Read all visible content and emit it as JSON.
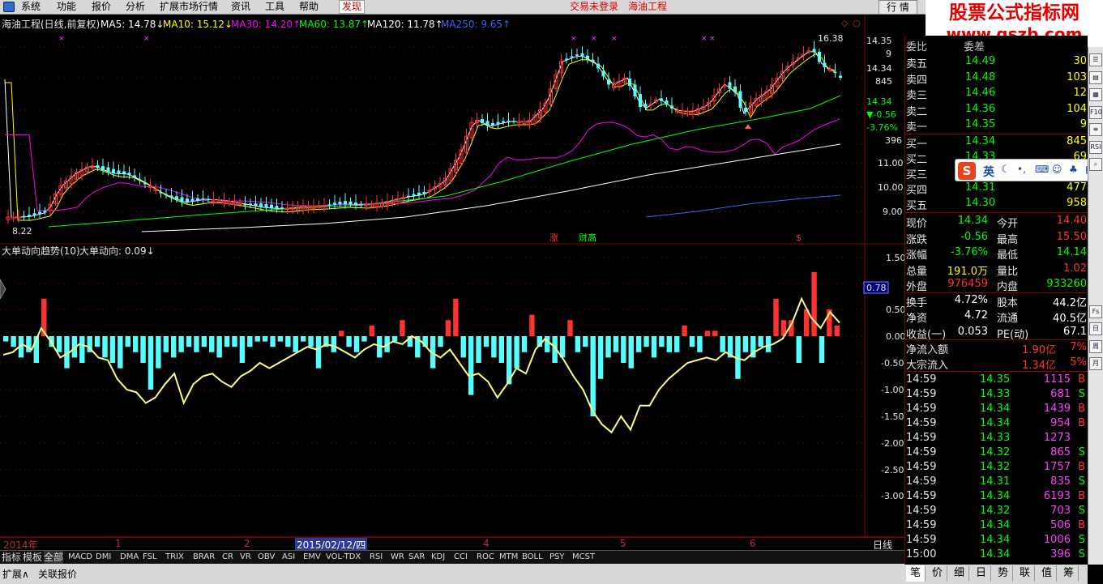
{
  "menu": {
    "items": [
      "系统",
      "功能",
      "报价",
      "分析",
      "扩展市场行情",
      "资讯",
      "工具",
      "帮助"
    ],
    "active": "发现",
    "login": "交易未登录",
    "stock_name": "海油工程",
    "trade_tab": "行 情"
  },
  "banner": {
    "line1": "股票公式指标网",
    "line2": "www.gszb.com"
  },
  "ma_legend": {
    "title": "海油工程(日线,前复权)",
    "ma5": "MA5: 14.78↓",
    "ma10": "MA10: 15.12↓",
    "ma30": "MA30: 14.20↑",
    "ma60": "MA60: 13.87↑",
    "ma120": "MA120: 11.78↑",
    "ma250": "MA250: 9.65↑"
  },
  "colors": {
    "ma5": "#ffffff",
    "ma10": "#ffff00",
    "ma30": "#ff00ff",
    "ma60": "#00ff00",
    "ma120": "#ffffff",
    "ma250": "#4060ff",
    "up": "#ff3232",
    "down": "#54ffff",
    "panel_border": "#8b0000",
    "price_red": "#ff3232",
    "price_green": "#00ff00",
    "label_grey": "#e6e6e6"
  },
  "price_axis": {
    "labels": [
      "14.35",
      "9",
      "14.34",
      "845",
      "14.34",
      "▼-0.56",
      "-3.76%",
      "396",
      "11.00",
      "10.00",
      "9.00"
    ],
    "high_label": "16.38",
    "low_label": "8.22"
  },
  "indicator": {
    "title": "大单动向趋势(10)",
    "sub": "大单动向: 0.09↓",
    "value_box": "0.78",
    "axis": [
      "1.50",
      "0.50",
      "0.00",
      "-0.50",
      "-1.00",
      "-1.50",
      "-2.00",
      "-2.50",
      "-3.00"
    ]
  },
  "date_axis": {
    "labels": [
      "2014年",
      "1",
      "2",
      "2015/02/12/四",
      "4",
      "5",
      "6"
    ],
    "period": "日线",
    "zoom": [
      "+",
      "-",
      "0"
    ]
  },
  "signal_labels": {
    "s1": "涨",
    "s2": "财高",
    "s3": "$"
  },
  "bottom_tabs": [
    "指标",
    "模板",
    "全部",
    "MACD",
    "DMI",
    "DMA",
    "FSL",
    "TRIX",
    "BRAR",
    "CR",
    "VR",
    "OBV",
    "ASI",
    "EMV",
    "VOL-TDX",
    "RSI",
    "WR",
    "SAR",
    "KDJ",
    "CCI",
    "ROC",
    "MTM",
    "BOLL",
    "PSY",
    "MCST"
  ],
  "status": {
    "expand": "扩展∧",
    "linked": "关联报价"
  },
  "order_book": {
    "top_partial": {
      "label": "委比",
      "value": "委差"
    },
    "asks": [
      {
        "label": "卖五",
        "price": "14.49",
        "vol": "30"
      },
      {
        "label": "卖四",
        "price": "14.48",
        "vol": "103"
      },
      {
        "label": "卖三",
        "price": "14.46",
        "vol": "12"
      },
      {
        "label": "卖二",
        "price": "14.36",
        "vol": "104"
      },
      {
        "label": "卖一",
        "price": "14.35",
        "vol": "9"
      }
    ],
    "bids": [
      {
        "label": "买一",
        "price": "14.34",
        "vol": "845"
      },
      {
        "label": "买二",
        "price": "14.33",
        "vol": "69"
      },
      {
        "label": "买三",
        "price": "",
        "vol": ""
      },
      {
        "label": "买四",
        "price": "14.31",
        "vol": "477"
      },
      {
        "label": "买五",
        "price": "14.30",
        "vol": "958"
      }
    ]
  },
  "quote": [
    {
      "l1": "现价",
      "v1": "14.34",
      "c1": "green",
      "l2": "今开",
      "v2": "14.40",
      "c2": "red"
    },
    {
      "l1": "涨跌",
      "v1": "-0.56",
      "c1": "green",
      "l2": "最高",
      "v2": "15.50",
      "c2": "red"
    },
    {
      "l1": "涨幅",
      "v1": "-3.76%",
      "c1": "green",
      "l2": "最低",
      "v2": "14.14",
      "c2": "green"
    },
    {
      "l1": "总量",
      "v1": "191.0万",
      "c1": "yellow",
      "l2": "量比",
      "v2": "1.02",
      "c2": "red"
    },
    {
      "l1": "外盘",
      "v1": "976459",
      "c1": "red",
      "l2": "内盘",
      "v2": "933260",
      "c2": "green"
    },
    {
      "l1": "换手",
      "v1": "4.72%",
      "c1": "white",
      "l2": "股本",
      "v2": "44.2亿",
      "c2": "white"
    },
    {
      "l1": "净资",
      "v1": "4.72",
      "c1": "white",
      "l2": "流通",
      "v2": "40.5亿",
      "c2": "white"
    },
    {
      "l1": "收益(一)",
      "v1": "0.053",
      "c1": "white",
      "l2": "PE(动)",
      "v2": "67.1",
      "c2": "white"
    }
  ],
  "flows": [
    {
      "label": "净流入额",
      "value": "1.90亿",
      "pct": "7%"
    },
    {
      "label": "大宗流入",
      "value": "1.34亿",
      "pct": "5%"
    }
  ],
  "ticks": [
    {
      "t": "14:59",
      "p": "14.35",
      "v": "1115",
      "s": "B"
    },
    {
      "t": "14:59",
      "p": "14.33",
      "v": "681",
      "s": "S"
    },
    {
      "t": "14:59",
      "p": "14.34",
      "v": "1439",
      "s": "B"
    },
    {
      "t": "14:59",
      "p": "14.34",
      "v": "954",
      "s": "B"
    },
    {
      "t": "14:59",
      "p": "14.33",
      "v": "1273",
      "s": ""
    },
    {
      "t": "14:59",
      "p": "14.32",
      "v": "865",
      "s": "S"
    },
    {
      "t": "14:59",
      "p": "14.32",
      "v": "1757",
      "s": "B"
    },
    {
      "t": "14:59",
      "p": "14.31",
      "v": "835",
      "s": "S"
    },
    {
      "t": "14:59",
      "p": "14.34",
      "v": "6193",
      "s": "B"
    },
    {
      "t": "14:59",
      "p": "14.32",
      "v": "703",
      "s": "S"
    },
    {
      "t": "14:59",
      "p": "14.34",
      "v": "506",
      "s": "B"
    },
    {
      "t": "14:59",
      "p": "14.34",
      "v": "1006",
      "s": "S"
    },
    {
      "t": "15:00",
      "p": "14.34",
      "v": "396",
      "s": "S"
    }
  ],
  "right_tabs": [
    "笔",
    "价",
    "细",
    "日",
    "势",
    "联",
    "值",
    "筹"
  ],
  "ime": {
    "label": "英"
  },
  "sidebar_icons": [
    "list-icon",
    "chart-icon",
    "grid-icon",
    "f10-icon",
    "news-icon",
    "rsi-icon",
    "search-icon",
    "fs-icon",
    "calendar-icon",
    "week-icon",
    "month-icon"
  ]
}
